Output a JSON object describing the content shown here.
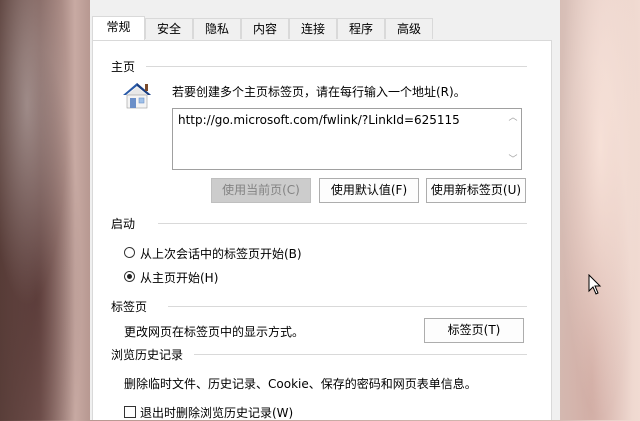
{
  "tabs": [
    {
      "label": "常规",
      "active": true
    },
    {
      "label": "安全"
    },
    {
      "label": "隐私"
    },
    {
      "label": "内容"
    },
    {
      "label": "连接"
    },
    {
      "label": "程序"
    },
    {
      "label": "高级"
    }
  ],
  "home": {
    "title": "主页",
    "description": "若要创建多个主页标签页，请在每行输入一个地址(R)。",
    "url": "http://go.microsoft.com/fwlink/?LinkId=625115",
    "buttons": {
      "use_current": "使用当前页(C)",
      "use_default": "使用默认值(F)",
      "use_new_tab": "使用新标签页(U)"
    }
  },
  "startup": {
    "title": "启动",
    "option_last_session": "从上次会话中的标签页开始(B)",
    "option_home": "从主页开始(H)",
    "selected": "home"
  },
  "tabs_section": {
    "title": "标签页",
    "description": "更改网页在标签页中的显示方式。",
    "button": "标签页(T)"
  },
  "history": {
    "title": "浏览历史记录",
    "description": "删除临时文件、历史记录、Cookie、保存的密码和网页表单信息。",
    "checkbox_label": "退出时删除浏览历史记录(W)",
    "checked": false
  },
  "colors": {
    "dialog_bg": "#f0f0f0",
    "panel_bg": "#ffffff",
    "disabled_button": "#cccccc"
  }
}
